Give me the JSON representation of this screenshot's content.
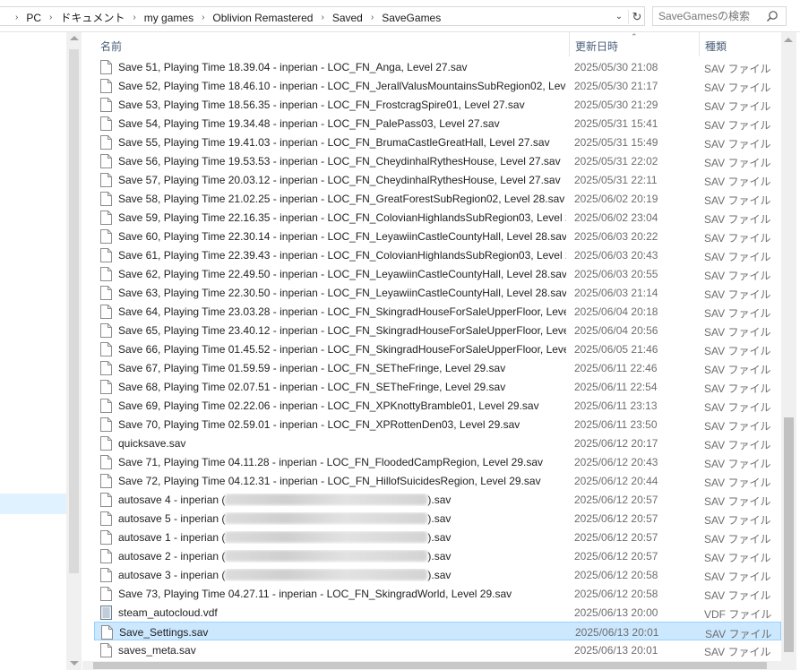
{
  "address": {
    "crumbs": [
      "PC",
      "ドキュメント",
      "my games",
      "Oblivion Remastered",
      "Saved",
      "SaveGames"
    ],
    "separator_icon": "chevron-right-icon"
  },
  "search": {
    "placeholder": "SaveGamesの検索",
    "icon": "search-icon"
  },
  "columns": {
    "name": "名前",
    "date": "更新日時",
    "type": "種類",
    "sorted_by": "date"
  },
  "files": [
    {
      "name": "Save 51, Playing Time 18.39.04 - inperian - LOC_FN_Anga, Level 27.sav",
      "date": "2025/05/30 21:08",
      "type": "SAV ファイル"
    },
    {
      "name": "Save 52, Playing Time 18.46.10 - inperian - LOC_FN_JerallValusMountainsSubRegion02, Level ...",
      "date": "2025/05/30 21:17",
      "type": "SAV ファイル"
    },
    {
      "name": "Save 53, Playing Time 18.56.35 - inperian - LOC_FN_FrostcragSpire01, Level 27.sav",
      "date": "2025/05/30 21:29",
      "type": "SAV ファイル"
    },
    {
      "name": "Save 54, Playing Time 19.34.48 - inperian - LOC_FN_PalePass03, Level 27.sav",
      "date": "2025/05/31 15:41",
      "type": "SAV ファイル"
    },
    {
      "name": "Save 55, Playing Time 19.41.03 - inperian - LOC_FN_BrumaCastleGreatHall, Level 27.sav",
      "date": "2025/05/31 15:49",
      "type": "SAV ファイル"
    },
    {
      "name": "Save 56, Playing Time 19.53.53 - inperian - LOC_FN_CheydinhalRythesHouse, Level 27.sav",
      "date": "2025/05/31 22:02",
      "type": "SAV ファイル"
    },
    {
      "name": "Save 57, Playing Time 20.03.12 - inperian - LOC_FN_CheydinhalRythesHouse, Level 27.sav",
      "date": "2025/05/31 22:11",
      "type": "SAV ファイル"
    },
    {
      "name": "Save 58, Playing Time 21.02.25 - inperian - LOC_FN_GreatForestSubRegion02, Level 28.sav",
      "date": "2025/06/02 20:19",
      "type": "SAV ファイル"
    },
    {
      "name": "Save 59, Playing Time 22.16.35 - inperian - LOC_FN_ColovianHighlandsSubRegion03, Level 28....",
      "date": "2025/06/02 23:04",
      "type": "SAV ファイル"
    },
    {
      "name": "Save 60, Playing Time 22.30.14 - inperian - LOC_FN_LeyawiinCastleCountyHall, Level 28.sav",
      "date": "2025/06/03 20:22",
      "type": "SAV ファイル"
    },
    {
      "name": "Save 61, Playing Time 22.39.43 - inperian - LOC_FN_ColovianHighlandsSubRegion03, Level 28....",
      "date": "2025/06/03 20:43",
      "type": "SAV ファイル"
    },
    {
      "name": "Save 62, Playing Time 22.49.50 - inperian - LOC_FN_LeyawiinCastleCountyHall, Level 28.sav",
      "date": "2025/06/03 20:55",
      "type": "SAV ファイル"
    },
    {
      "name": "Save 63, Playing Time 22.30.50 - inperian - LOC_FN_LeyawiinCastleCountyHall, Level 28.sav",
      "date": "2025/06/03 21:14",
      "type": "SAV ファイル"
    },
    {
      "name": "Save 64, Playing Time 23.03.28 - inperian - LOC_FN_SkingradHouseForSaleUpperFloor, Level 2...",
      "date": "2025/06/04 20:18",
      "type": "SAV ファイル"
    },
    {
      "name": "Save 65, Playing Time 23.40.12 - inperian - LOC_FN_SkingradHouseForSaleUpperFloor, Level 2...",
      "date": "2025/06/04 20:56",
      "type": "SAV ファイル"
    },
    {
      "name": "Save 66, Playing Time 01.45.52 - inperian - LOC_FN_SkingradHouseForSaleUpperFloor, Level 2...",
      "date": "2025/06/05 21:46",
      "type": "SAV ファイル"
    },
    {
      "name": "Save 67, Playing Time 01.59.59 - inperian - LOC_FN_SETheFringe, Level 29.sav",
      "date": "2025/06/11 22:46",
      "type": "SAV ファイル"
    },
    {
      "name": "Save 68, Playing Time 02.07.51 - inperian - LOC_FN_SETheFringe, Level 29.sav",
      "date": "2025/06/11 22:54",
      "type": "SAV ファイル"
    },
    {
      "name": "Save 69, Playing Time 02.22.06 - inperian - LOC_FN_XPKnottyBramble01, Level 29.sav",
      "date": "2025/06/11 23:13",
      "type": "SAV ファイル"
    },
    {
      "name": "Save 70, Playing Time 02.59.01 - inperian - LOC_FN_XPRottenDen03, Level 29.sav",
      "date": "2025/06/11 23:50",
      "type": "SAV ファイル"
    },
    {
      "name": "quicksave.sav",
      "date": "2025/06/12 20:17",
      "type": "SAV ファイル"
    },
    {
      "name": "Save 71, Playing Time 04.11.28 - inperian - LOC_FN_FloodedCampRegion, Level 29.sav",
      "date": "2025/06/12 20:43",
      "type": "SAV ファイル"
    },
    {
      "name": "Save 72, Playing Time 04.12.31 - inperian - LOC_FN_HillofSuicidesRegion, Level 29.sav",
      "date": "2025/06/12 20:44",
      "type": "SAV ファイル"
    },
    {
      "name": "autosave 4 - inperian (",
      "name_suffix": ").sav",
      "redacted": true,
      "date": "2025/06/12 20:57",
      "type": "SAV ファイル"
    },
    {
      "name": "autosave 5 - inperian (",
      "name_suffix": ").sav",
      "redacted": true,
      "date": "2025/06/12 20:57",
      "type": "SAV ファイル"
    },
    {
      "name": "autosave 1 - inperian (",
      "name_suffix": ").sav",
      "redacted": true,
      "date": "2025/06/12 20:57",
      "type": "SAV ファイル"
    },
    {
      "name": "autosave 2 - inperian (",
      "name_suffix": ").sav",
      "redacted": true,
      "date": "2025/06/12 20:57",
      "type": "SAV ファイル"
    },
    {
      "name": "autosave 3 - inperian (",
      "name_suffix": ").sav",
      "redacted": true,
      "date": "2025/06/12 20:58",
      "type": "SAV ファイル"
    },
    {
      "name": "Save 73, Playing Time 04.27.11 - inperian - LOC_FN_SkingradWorld, Level 29.sav",
      "date": "2025/06/12 20:58",
      "type": "SAV ファイル"
    },
    {
      "name": "steam_autocloud.vdf",
      "date": "2025/06/13 20:00",
      "type": "VDF ファイル",
      "icon": "text-file-icon"
    },
    {
      "name": "Save_Settings.sav",
      "date": "2025/06/13 20:01",
      "type": "SAV ファイル",
      "selected": true
    },
    {
      "name": "saves_meta.sav",
      "date": "2025/06/13 20:01",
      "type": "SAV ファイル"
    }
  ],
  "colors": {
    "selection": "#cce8ff",
    "selection_border": "#99d1ff",
    "header_text": "#4c607a",
    "muted_text": "#6d6d6d"
  }
}
